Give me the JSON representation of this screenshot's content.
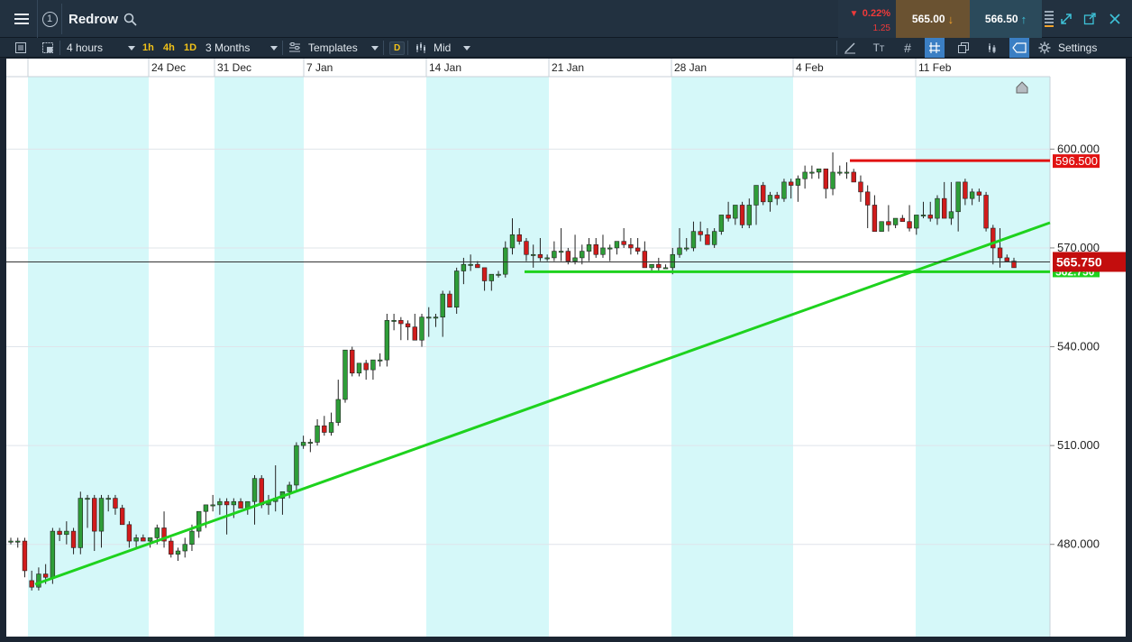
{
  "header": {
    "instrument": "Redrow",
    "change_pct": "0.22%",
    "change_abs": "1.25",
    "sell_price": "565.00",
    "buy_price": "566.50"
  },
  "toolbar": {
    "interval": "4 hours",
    "quick_intervals": [
      "1h",
      "4h",
      "1D"
    ],
    "range": "3 Months",
    "templates_label": "Templates",
    "d_label": "D",
    "price_type": "Mid",
    "settings_label": "Settings"
  },
  "colors": {
    "bull": "#2e9d38",
    "bear": "#d11b1b",
    "trend": "#1ed21e",
    "resistance": "#e11212",
    "shade": "#d5f8f9",
    "accent": "#3b7fc4"
  },
  "chart_data": {
    "type": "candlestick",
    "date_labels": [
      "24 Dec",
      "31 Dec",
      "7 Jan",
      "14 Jan",
      "21 Jan",
      "28 Jan",
      "4 Feb",
      "11 Feb"
    ],
    "y_ticks": [
      "600.000",
      "570.000",
      "540.000",
      "510.000",
      "480.000"
    ],
    "current_price_label": "565.750",
    "resistance_label": "596.500",
    "support_label": "562.750",
    "current_price": 565.75,
    "resistance_price": 596.5,
    "support_price": 562.75,
    "ylim": [
      452,
      622
    ],
    "candles": [
      [
        481,
        482,
        480,
        481
      ],
      [
        481,
        482,
        479,
        481
      ],
      [
        481,
        482,
        470,
        472
      ],
      [
        469,
        472,
        466,
        467
      ],
      [
        467,
        473,
        466,
        471
      ],
      [
        471,
        474,
        468,
        470
      ],
      [
        470,
        485,
        468,
        484
      ],
      [
        484,
        485,
        481,
        483
      ],
      [
        483,
        487,
        480,
        484
      ],
      [
        484,
        485,
        477,
        479
      ],
      [
        479,
        496,
        477,
        494
      ],
      [
        494,
        495,
        485,
        494
      ],
      [
        494,
        495,
        478,
        484
      ],
      [
        484,
        495,
        479,
        494
      ],
      [
        494,
        495,
        490,
        494
      ],
      [
        494,
        495,
        489,
        491
      ],
      [
        491,
        492,
        486,
        486
      ],
      [
        486,
        487,
        479,
        481
      ],
      [
        481,
        483,
        479,
        482
      ],
      [
        482,
        483,
        481,
        481
      ],
      [
        481,
        482,
        479,
        482
      ],
      [
        482,
        486,
        480,
        485
      ],
      [
        485,
        490,
        479,
        481
      ],
      [
        481,
        482,
        476,
        477
      ],
      [
        477,
        479,
        475,
        478
      ],
      [
        478,
        482,
        476,
        480
      ],
      [
        480,
        486,
        478,
        484
      ],
      [
        484,
        490,
        482,
        490
      ],
      [
        490,
        492,
        485,
        492
      ],
      [
        492,
        495,
        490,
        492
      ],
      [
        492,
        494,
        489,
        493
      ],
      [
        493,
        494,
        483,
        492
      ],
      [
        492,
        494,
        488,
        493
      ],
      [
        493,
        494,
        491,
        491
      ],
      [
        491,
        492,
        489,
        493
      ],
      [
        493,
        501,
        486,
        500
      ],
      [
        500,
        501,
        491,
        492
      ],
      [
        492,
        495,
        489,
        493
      ],
      [
        493,
        504,
        490,
        494
      ],
      [
        494,
        496,
        489,
        496
      ],
      [
        496,
        499,
        494,
        498
      ],
      [
        498,
        511,
        496,
        510
      ],
      [
        510,
        513,
        509,
        511
      ],
      [
        511,
        512,
        508,
        511
      ],
      [
        511,
        518,
        510,
        516
      ],
      [
        516,
        519,
        513,
        514
      ],
      [
        514,
        520,
        513,
        517
      ],
      [
        517,
        530,
        516,
        524
      ],
      [
        524,
        539,
        523,
        539
      ],
      [
        539,
        540,
        531,
        532
      ],
      [
        532,
        535,
        531,
        535
      ],
      [
        535,
        536,
        530,
        533
      ],
      [
        533,
        536,
        530,
        536
      ],
      [
        536,
        538,
        534,
        536
      ],
      [
        536,
        550,
        534,
        548
      ],
      [
        548,
        550,
        545,
        548
      ],
      [
        548,
        549,
        542,
        547
      ],
      [
        547,
        548,
        542,
        546
      ],
      [
        546,
        550,
        543,
        542
      ],
      [
        542,
        550,
        540,
        549
      ],
      [
        549,
        552,
        543,
        549
      ],
      [
        549,
        550,
        546,
        549
      ],
      [
        549,
        557,
        543,
        556
      ],
      [
        556,
        557,
        552,
        552
      ],
      [
        552,
        564,
        550,
        563
      ],
      [
        563,
        567,
        559,
        565
      ],
      [
        565,
        568,
        563,
        565
      ],
      [
        565,
        566,
        564,
        564
      ],
      [
        564,
        564,
        557,
        560
      ],
      [
        560,
        562,
        557,
        562
      ],
      [
        562,
        563,
        561,
        562
      ],
      [
        562,
        572,
        561,
        570
      ],
      [
        570,
        579,
        568,
        574
      ],
      [
        574,
        576,
        571,
        572
      ],
      [
        572,
        573,
        566,
        568
      ],
      [
        568,
        571,
        564,
        568
      ],
      [
        568,
        573,
        566,
        567
      ],
      [
        567,
        568,
        566,
        567
      ],
      [
        567,
        572,
        566,
        569
      ],
      [
        569,
        576,
        566,
        569
      ],
      [
        569,
        570,
        565,
        566
      ],
      [
        566,
        574,
        565,
        567
      ],
      [
        567,
        571,
        565,
        569
      ],
      [
        569,
        573,
        566,
        571
      ],
      [
        571,
        573,
        567,
        568
      ],
      [
        568,
        574,
        567,
        570
      ],
      [
        570,
        571,
        566,
        570
      ],
      [
        570,
        571,
        568,
        572
      ],
      [
        572,
        576,
        570,
        571
      ],
      [
        571,
        573,
        568,
        570
      ],
      [
        570,
        573,
        568,
        569
      ],
      [
        569,
        572,
        565,
        564
      ],
      [
        564,
        565,
        563,
        565
      ],
      [
        565,
        567,
        563,
        564
      ],
      [
        564,
        565,
        564,
        564
      ],
      [
        564,
        570,
        562,
        568
      ],
      [
        568,
        576,
        567,
        570
      ],
      [
        570,
        573,
        569,
        570
      ],
      [
        570,
        578,
        569,
        575
      ],
      [
        575,
        578,
        572,
        574
      ],
      [
        574,
        576,
        571,
        571
      ],
      [
        571,
        576,
        570,
        575
      ],
      [
        575,
        580,
        574,
        580
      ],
      [
        580,
        584,
        578,
        579
      ],
      [
        579,
        583,
        577,
        583
      ],
      [
        583,
        584,
        576,
        577
      ],
      [
        577,
        585,
        576,
        583
      ],
      [
        583,
        586,
        577,
        589
      ],
      [
        589,
        590,
        583,
        584
      ],
      [
        584,
        587,
        581,
        586
      ],
      [
        586,
        587,
        583,
        585
      ],
      [
        585,
        591,
        584,
        590
      ],
      [
        590,
        591,
        585,
        589
      ],
      [
        589,
        592,
        584,
        591
      ],
      [
        591,
        595,
        588,
        593
      ],
      [
        593,
        595,
        591,
        593
      ],
      [
        593,
        594,
        591,
        594
      ],
      [
        594,
        594,
        585,
        588
      ],
      [
        588,
        599,
        586,
        593
      ],
      [
        593,
        595,
        592,
        593
      ],
      [
        593,
        596,
        591,
        593
      ],
      [
        593,
        594,
        590,
        590
      ],
      [
        590,
        592,
        584,
        587
      ],
      [
        587,
        589,
        576,
        583
      ],
      [
        583,
        586,
        576,
        575
      ],
      [
        575,
        576,
        575,
        578
      ],
      [
        578,
        583,
        575,
        577
      ],
      [
        577,
        579,
        576,
        579
      ],
      [
        579,
        580,
        578,
        578
      ],
      [
        578,
        583,
        575,
        576
      ],
      [
        576,
        578,
        574,
        580
      ],
      [
        580,
        584,
        579,
        580
      ],
      [
        580,
        584,
        578,
        579
      ],
      [
        579,
        586,
        577,
        585
      ],
      [
        585,
        590,
        583,
        579
      ],
      [
        579,
        590,
        577,
        581
      ],
      [
        581,
        589,
        575,
        590
      ],
      [
        590,
        591,
        583,
        585
      ],
      [
        585,
        588,
        583,
        587
      ],
      [
        587,
        588,
        584,
        586
      ],
      [
        586,
        587,
        575,
        576
      ],
      [
        576,
        577,
        565,
        570
      ],
      [
        570,
        576,
        564,
        567
      ],
      [
        567,
        568,
        566,
        566
      ],
      [
        566,
        567,
        564,
        564
      ]
    ]
  }
}
